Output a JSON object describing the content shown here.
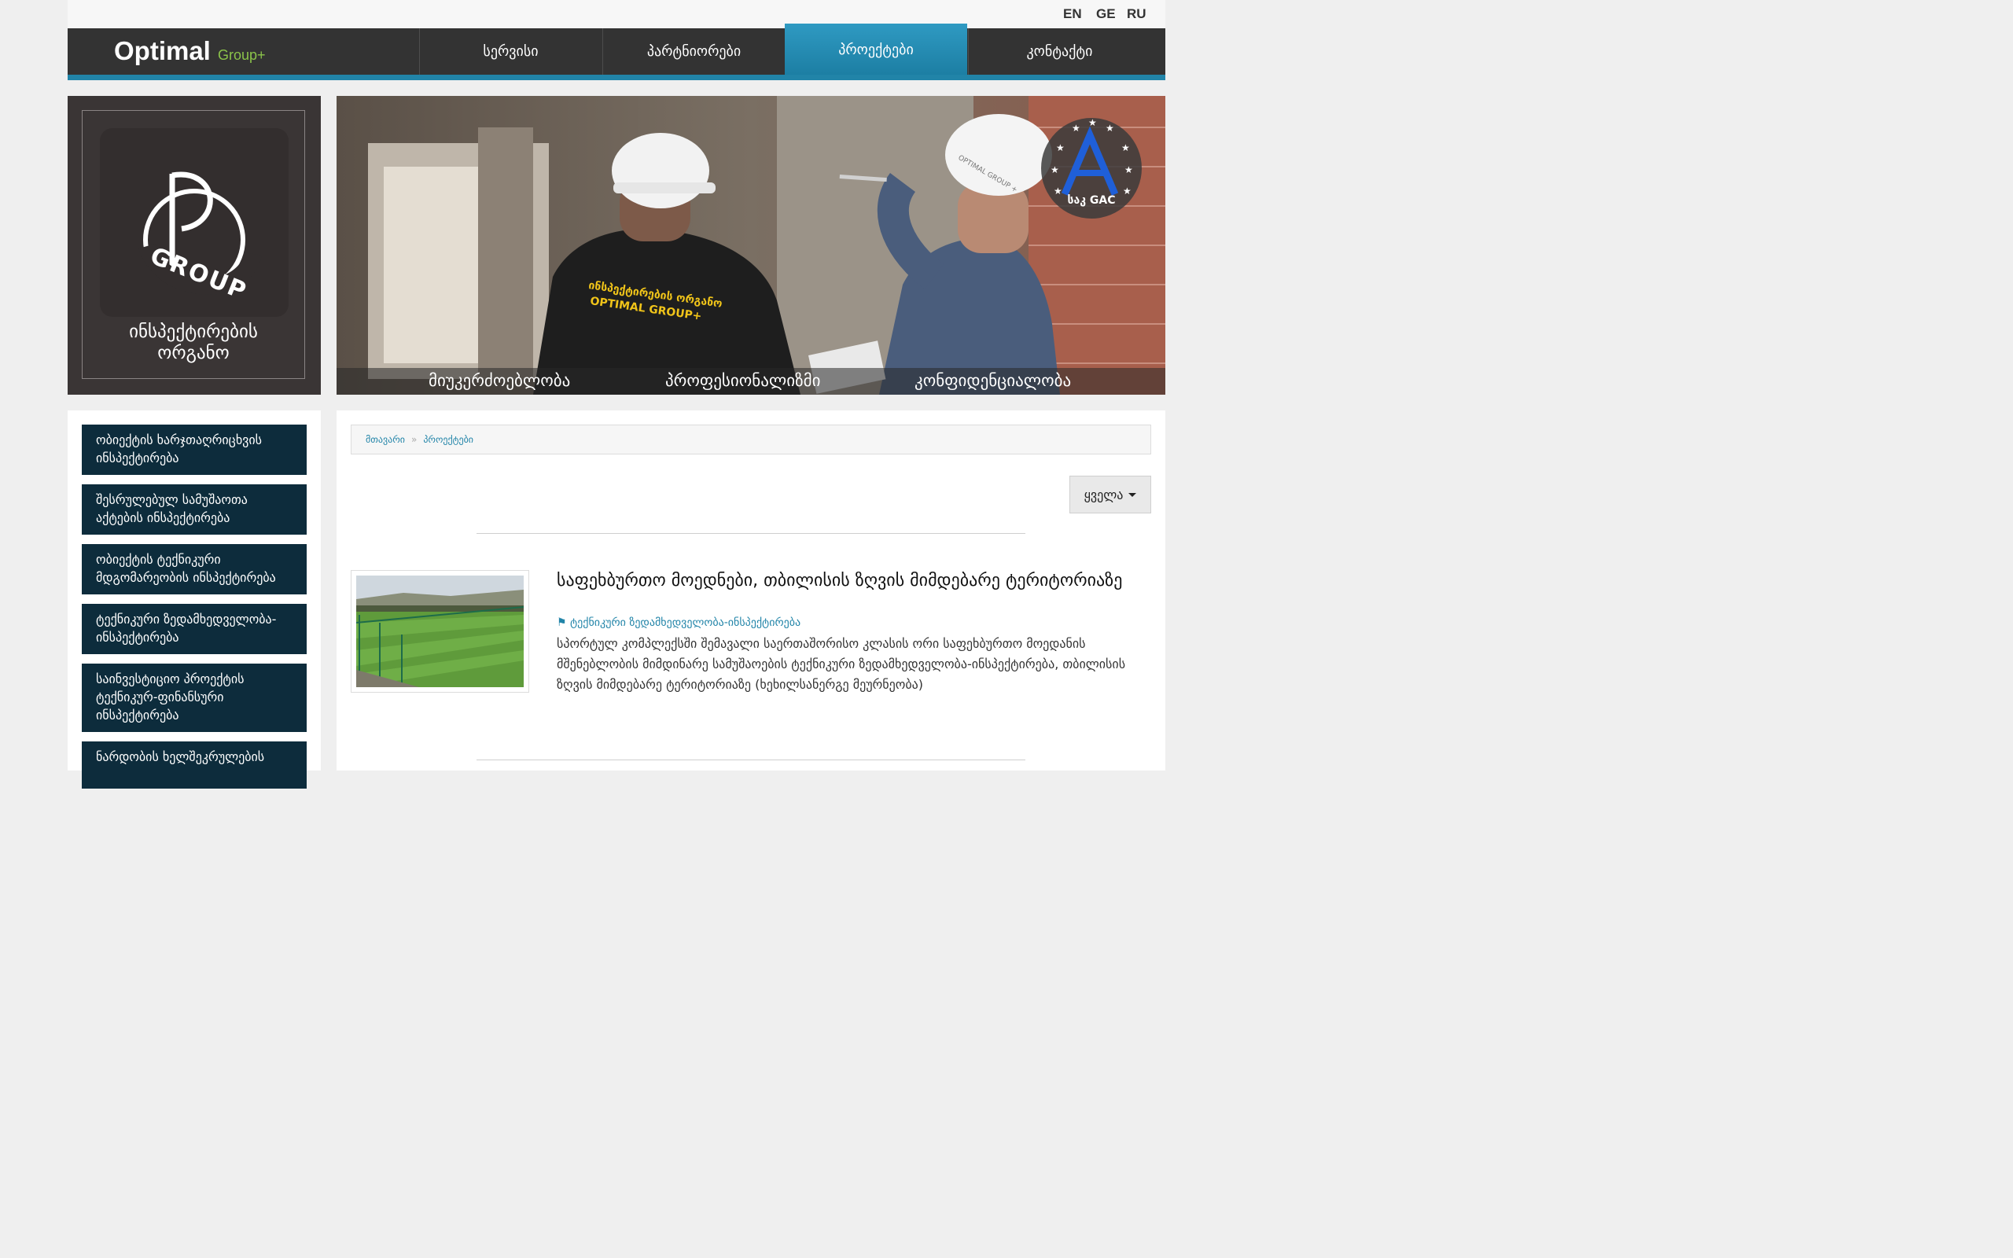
{
  "languages": [
    "EN",
    "GE",
    "RU"
  ],
  "brand": {
    "name": "Optimal",
    "suffix": "Group+"
  },
  "nav": {
    "items": [
      "სერვისი",
      "პარტნიორები",
      "პროექტები",
      "კონტაქტი"
    ],
    "active_index": 2
  },
  "logo_box": {
    "logo_text": "Optimal GROUP",
    "caption_line1": "ინსპექტირების",
    "caption_line2": "ორგანო"
  },
  "hero": {
    "badge_text": "საკ GAC",
    "jacket_text_1": "ინსპექტირების ორგანო",
    "jacket_text_2": "OPTIMAL GROUP+",
    "helmet_text": "OPTIMAL GROUP +",
    "values": [
      "მიუკერძოებლობა",
      "პროფესიონალიზმი",
      "კონფიდენციალობა"
    ]
  },
  "sidebar": {
    "items": [
      "ობიექტის ხარჯთაღრიცხვის ინსპექტირება",
      "შესრულებულ სამუშაოთა აქტების ინსპექტირება",
      "ობიექტის ტექნიკური მდგომარეობის ინსპექტირება",
      "ტექნიკური ზედამხედველობა-ინსპექტირება",
      "საინვესტიციო პროექტის ტექნიკურ-ფინანსური ინსპექტირება",
      "ნარდობის ხელშეკრულების"
    ]
  },
  "breadcrumb": {
    "home": "მთავარი",
    "separator": "»",
    "current": "პროექტები"
  },
  "filter": {
    "label": "ყველა"
  },
  "project": {
    "title": "საფეხბურთო მოედნები, თბილისის ზღვის მიმდებარე ტერიტორიაზე",
    "tag": "ტექნიკური ზედამხედველობა-ინსპექტირება",
    "description": "სპორტულ კომპლექსში შემავალი საერთაშორისო კლასის ორი საფეხბურთო მოედანის მშენებლობის მიმდინარე სამუშაოების ტექნიკური ზედამხედველობა-ინსპექტირება, თბილისის ზღვის მიმდებარე ტერიტორიაზე (ხეხილსანერგე მეურნეობა)"
  },
  "colors": {
    "nav_bg": "#333333",
    "accent": "#2184a8",
    "brand_sub": "#8bc34a",
    "sidebar_item_bg": "#0d2c3c",
    "logo_box_bg": "#3a3535"
  }
}
